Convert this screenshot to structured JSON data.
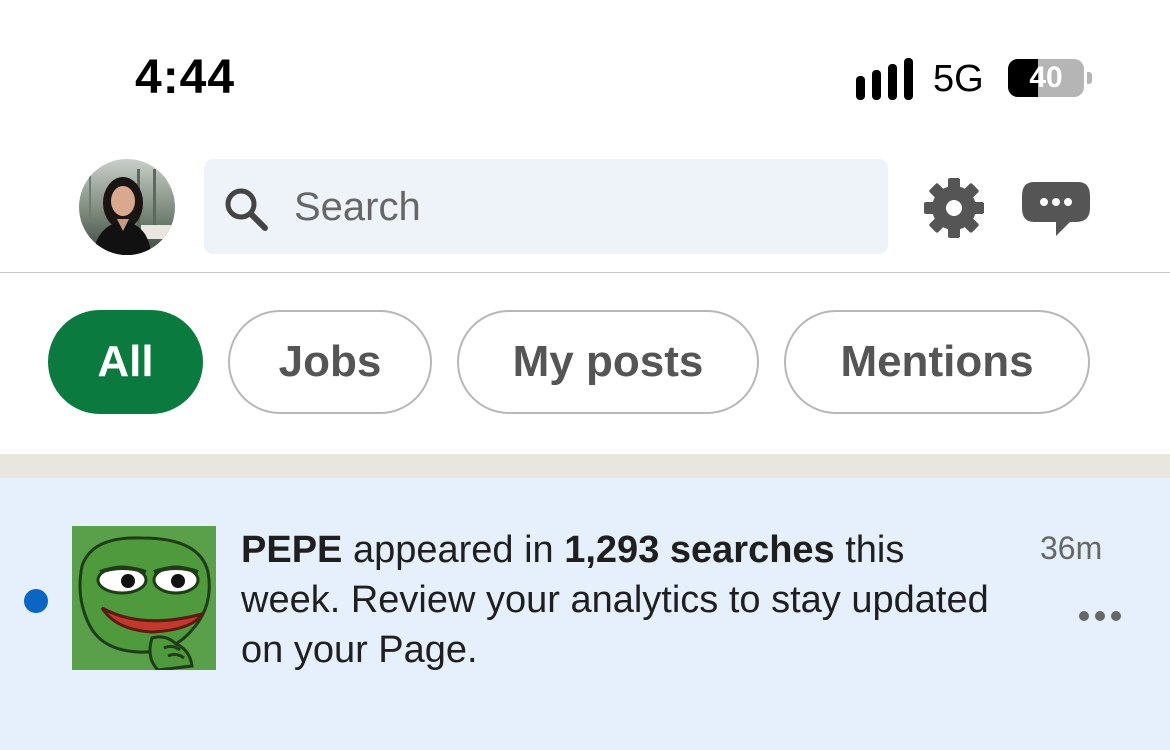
{
  "status_bar": {
    "time": "4:44",
    "network": "5G",
    "battery_level": "40",
    "battery_fraction": 0.4
  },
  "header": {
    "search_placeholder": "Search"
  },
  "filters": [
    {
      "label": "All",
      "active": true
    },
    {
      "label": "Jobs",
      "active": false
    },
    {
      "label": "My posts",
      "active": false
    },
    {
      "label": "Mentions",
      "active": false
    }
  ],
  "notification": {
    "unread": true,
    "name": "PEPE",
    "text_1": " appeared in ",
    "highlight": "1,293 searches",
    "text_2": " this week. Review your analytics to stay updated on your Page.",
    "time_ago": "36m"
  },
  "colors": {
    "brand_green": "#0b7a3e",
    "unread_blue": "#0a66c2",
    "notification_bg": "#e6f0fc"
  },
  "icons": {
    "search": "search-icon",
    "settings": "gear-icon",
    "messaging": "message-icon",
    "more": "more-horizontal-icon"
  }
}
